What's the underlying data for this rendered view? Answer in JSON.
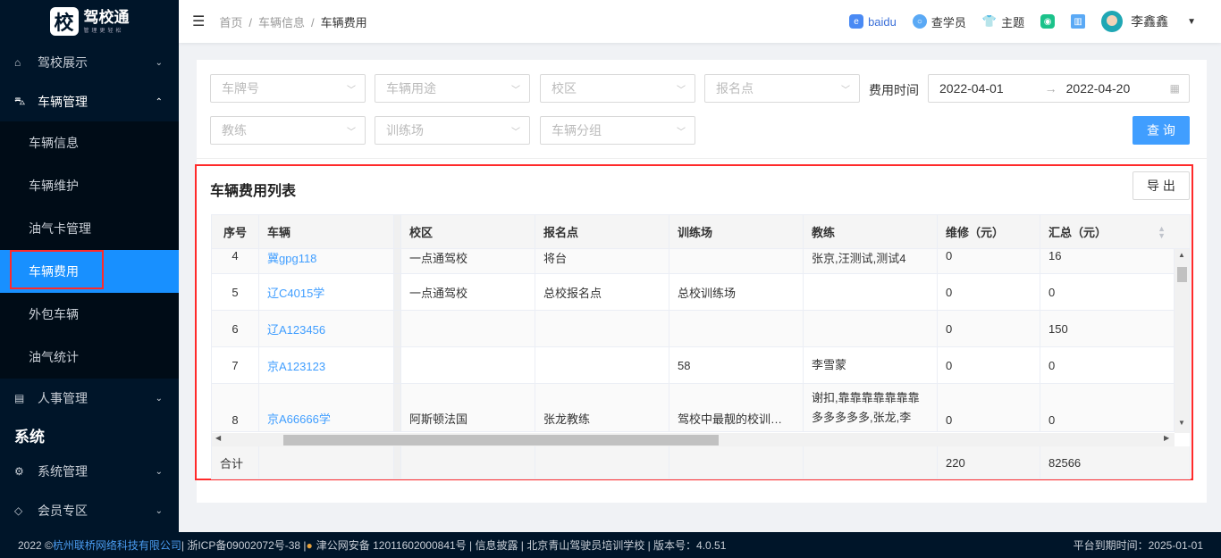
{
  "sidebar": {
    "logo_mark": "校",
    "logo_title": "驾校通",
    "logo_sub": "管理更轻松",
    "items": [
      {
        "label": "驾校展示"
      },
      {
        "label": "车辆管理"
      },
      {
        "label": "人事管理"
      }
    ],
    "sub_items": [
      {
        "label": "车辆信息"
      },
      {
        "label": "车辆维护"
      },
      {
        "label": "油气卡管理"
      },
      {
        "label": "车辆费用"
      },
      {
        "label": "外包车辆"
      },
      {
        "label": "油气统计"
      }
    ],
    "group": "系统",
    "group_items": [
      {
        "label": "系统管理"
      },
      {
        "label": "会员专区"
      }
    ]
  },
  "header": {
    "breadcrumb": [
      "首页",
      "车辆信息",
      "车辆费用"
    ],
    "baidu": "baidu",
    "search_student": "查学员",
    "theme": "主题",
    "user": "李鑫鑫"
  },
  "filters": {
    "plate": "车牌号",
    "usage": "车辆用途",
    "campus": "校区",
    "signup": "报名点",
    "time_label": "费用时间",
    "date_start": "2022-04-01",
    "date_end": "2022-04-20",
    "coach": "教练",
    "field": "训练场",
    "group": "车辆分组",
    "query": "查 询"
  },
  "table": {
    "title": "车辆费用列表",
    "export": "导 出",
    "headers": [
      "序号",
      "车辆",
      "校区",
      "报名点",
      "训练场",
      "教练",
      "维修（元）",
      "汇总（元）"
    ],
    "rows": [
      [
        "4",
        "冀gpg118",
        "一点通驾校",
        "将台",
        "",
        "张京,汪测试,测试4",
        "0",
        "16"
      ],
      [
        "5",
        "辽C4015学",
        "一点通驾校",
        "总校报名点",
        "总校训练场",
        "",
        "0",
        "0"
      ],
      [
        "6",
        "辽A123456",
        "",
        "",
        "",
        "",
        "0",
        "150"
      ],
      [
        "7",
        "京A123123",
        "",
        "",
        "58",
        "李雪蒙",
        "0",
        "0"
      ],
      [
        "8",
        "京A66666学",
        "阿斯顿法国",
        "张龙教练",
        "驾校中最靓的校训…",
        "谢扣,靠靠靠靠靠靠靠\n多多多多多,张龙,李",
        "0",
        "0"
      ]
    ],
    "footer": {
      "label": "合计",
      "repair": "220",
      "total": "82566"
    }
  },
  "footer": {
    "year": "2022 ©",
    "company": "杭州联桥网络科技有限公司",
    "icp": " | 浙ICP备09002072号-38 | ",
    "police": "津公网安备 12011602000841号 | 信息披露 | 北京青山驾驶员培训学校 | 版本号：4.0.51",
    "expire": "平台到期时间：2025-01-01"
  }
}
